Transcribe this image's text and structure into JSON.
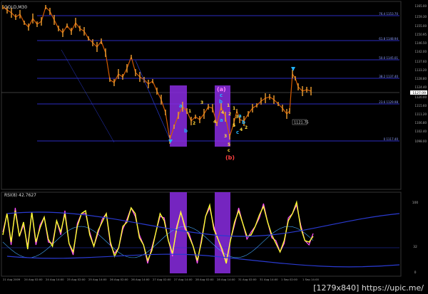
{
  "header": {
    "title": "GOLD,M30"
  },
  "indicator": {
    "title": "RSI(8) 42.7627"
  },
  "watermark": "[1279x840] https://upic.me/",
  "price_axis": [
    "1165.00",
    "1159.30",
    "1155.00",
    "1150.95",
    "1146.50",
    "1142.00",
    "1137.60",
    "1133.20",
    "1128.80",
    "1124.40",
    "1120.00",
    "1115.60",
    "1111.20",
    "1106.80",
    "1102.40",
    "1098.00"
  ],
  "fib_labels": [
    "76.4 1153.70",
    "61.8 1148.94",
    "50.0 1145.01",
    "38.2 1137.40",
    "23.6 1129.98",
    "0 1117.40"
  ],
  "rsi_axis": [
    "100",
    "32",
    "0"
  ],
  "price_box": "1127.09",
  "box_label": "1121.75",
  "time_axis": [
    "21 Aug 2009",
    "24 Aug 02:00",
    "24 Aug 14:00",
    "25 Aug 02:00",
    "25 Aug 14:00",
    "26 Aug 02:00",
    "26 Aug 14:00",
    "27 Aug 02:00",
    "27 Aug 14:00",
    "28 Aug 02:00",
    "28 Aug 14:00",
    "31 Aug 02:00",
    "31 Aug 14:00",
    "1 Sep 02:00",
    "1 Sep 14:00"
  ],
  "wave_labels": {
    "box1": [
      "a",
      "b",
      "1",
      "2",
      "3",
      "4",
      "5"
    ],
    "box2": [
      "(a)",
      "c",
      "b",
      "a",
      "1",
      "2",
      "3",
      "4",
      "5",
      "c",
      "(b)"
    ],
    "right": [
      "1",
      "2",
      "3",
      "4",
      "5",
      "a",
      "b",
      "c"
    ]
  },
  "colors": {
    "background": "#000000",
    "grid": "#2c2c7a",
    "candle": "#f0a030",
    "rsi": "#ffff30",
    "highlight": "#8a2be2",
    "fib": "#3a3aff",
    "wave_cyan": "#22b4ff",
    "wave_yellow": "#ffd83a",
    "wave_red": "#ff4040",
    "wave_pink": "#ff80ff"
  }
}
